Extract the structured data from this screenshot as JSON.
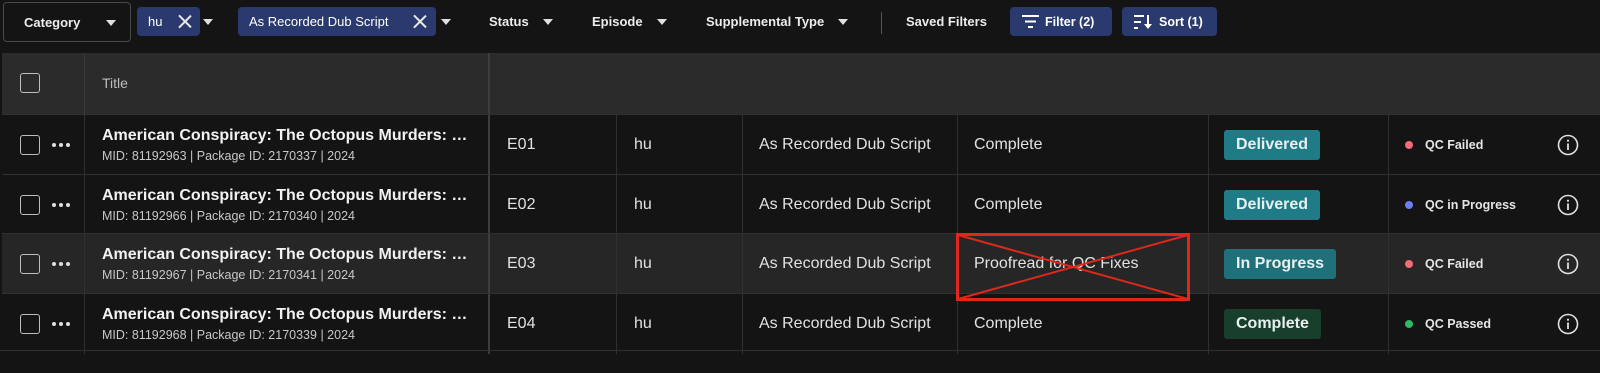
{
  "filters": {
    "category_label": "Category",
    "chips": [
      {
        "label": "hu"
      },
      {
        "label": "As Recorded Dub Script"
      }
    ],
    "dropdowns": [
      "Status",
      "Episode",
      "Supplemental Type"
    ],
    "saved_filters_label": "Saved Filters",
    "filter_button": "Filter (2)",
    "sort_button": "Sort (1)"
  },
  "table": {
    "header": {
      "title": "Title"
    },
    "rows": [
      {
        "title": "American Conspiracy: The Octopus Murders: Limited Series",
        "meta": "MID: 81192963 | Package ID: 2170337 | 2024",
        "episode": "E01",
        "language": "hu",
        "type": "As Recorded Dub Script",
        "task": "Complete",
        "status": "Delivered",
        "status_color": "#1f7c86",
        "qc": "QC Failed",
        "qc_color": "#f26b78",
        "highlighted": false
      },
      {
        "title": "American Conspiracy: The Octopus Murders: Limited Series",
        "meta": "MID: 81192966 | Package ID: 2170340 | 2024",
        "episode": "E02",
        "language": "hu",
        "type": "As Recorded Dub Script",
        "task": "Complete",
        "status": "Delivered",
        "status_color": "#1f7c86",
        "qc": "QC in Progress",
        "qc_color": "#6b7ff0",
        "highlighted": false
      },
      {
        "title": "American Conspiracy: The Octopus Murders: Limited Series",
        "meta": "MID: 81192967 | Package ID: 2170341 | 2024",
        "episode": "E03",
        "language": "hu",
        "type": "As Recorded Dub Script",
        "task": "Proofread for QC Fixes",
        "status": "In Progress",
        "status_color": "#1f7078",
        "qc": "QC Failed",
        "qc_color": "#f26b78",
        "highlighted": true
      },
      {
        "title": "American Conspiracy: The Octopus Murders: Limited Series",
        "meta": "MID: 81192968 | Package ID: 2170339 | 2024",
        "episode": "E04",
        "language": "hu",
        "type": "As Recorded Dub Script",
        "task": "Complete",
        "status": "Complete",
        "status_color": "#173f2c",
        "qc": "QC Passed",
        "qc_color": "#2fb866",
        "highlighted": false
      }
    ]
  },
  "icons": {
    "close": "close-icon",
    "caret": "caret-down-icon",
    "filter": "filter-icon",
    "sort": "sort-icon",
    "more": "more-icon",
    "info": "info-icon"
  },
  "annotation_color": "#e0271b"
}
